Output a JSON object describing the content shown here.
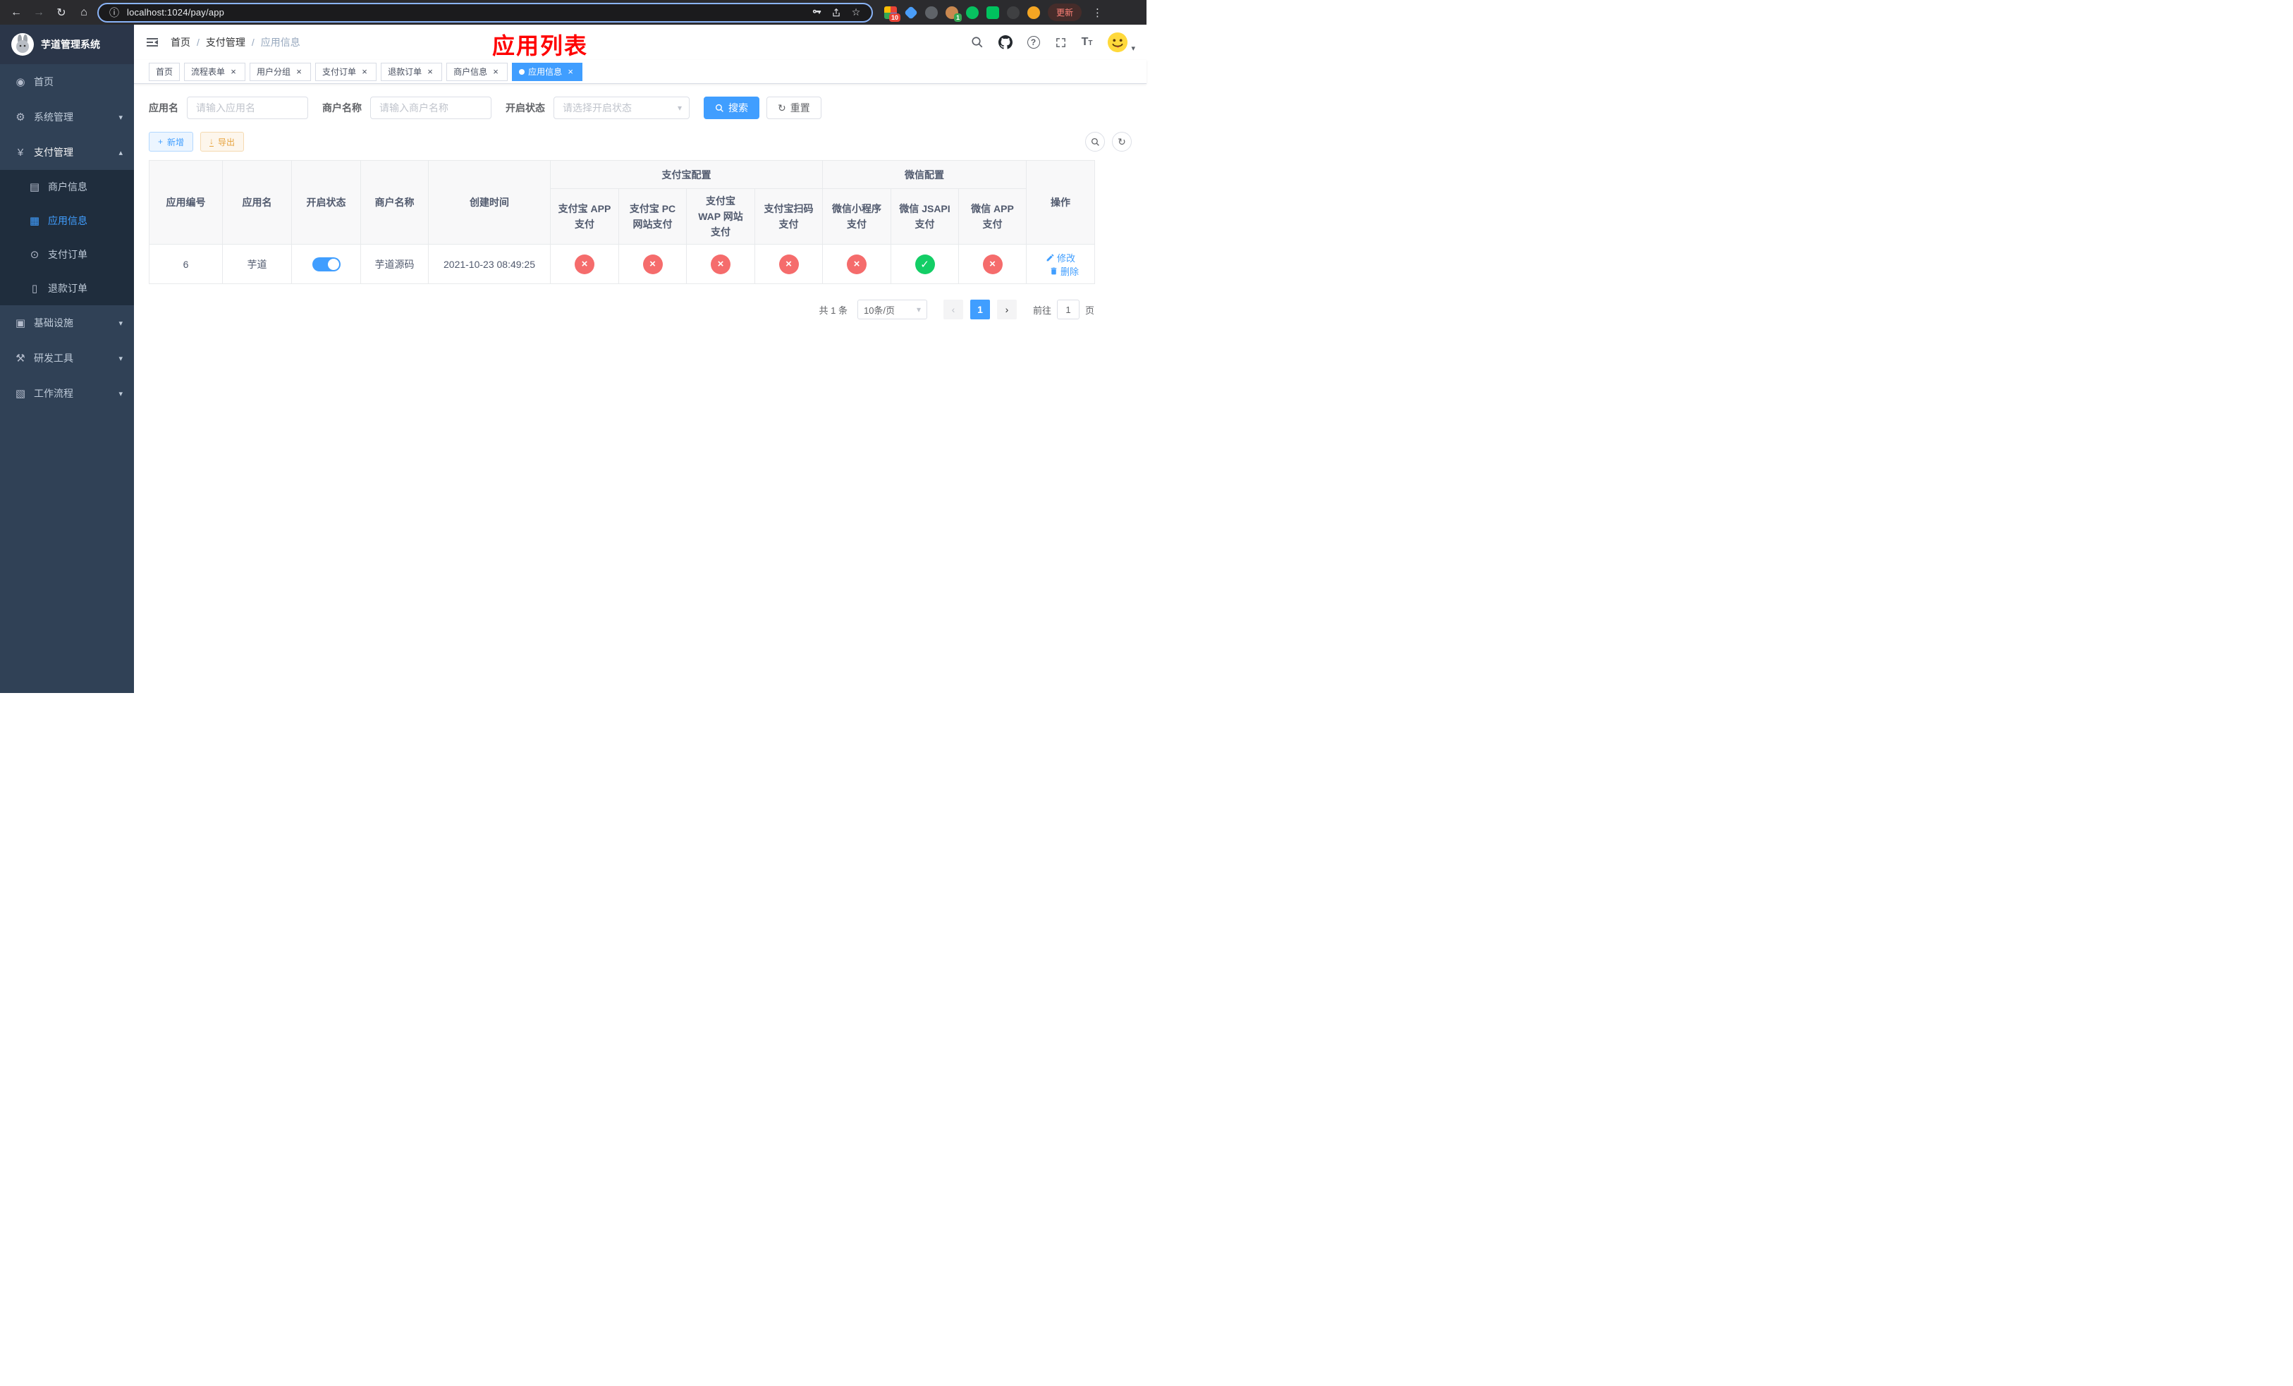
{
  "browser": {
    "url": "localhost:1024/pay/app",
    "update_label": "更新",
    "ext_badge_count": "10",
    "ext_badge_one": "1"
  },
  "sidebar": {
    "title": "芋道管理系统",
    "menu": [
      {
        "label": "首页"
      },
      {
        "label": "系统管理"
      },
      {
        "label": "支付管理"
      },
      {
        "label": "商户信息"
      },
      {
        "label": "应用信息"
      },
      {
        "label": "支付订单"
      },
      {
        "label": "退款订单"
      },
      {
        "label": "基础设施"
      },
      {
        "label": "研发工具"
      },
      {
        "label": "工作流程"
      }
    ]
  },
  "navbar": {
    "breadcrumb": {
      "home": "首页",
      "section": "支付管理",
      "current": "应用信息"
    },
    "annotation": "应用列表"
  },
  "tabs": [
    {
      "label": "首页"
    },
    {
      "label": "流程表单"
    },
    {
      "label": "用户分组"
    },
    {
      "label": "支付订单"
    },
    {
      "label": "退款订单"
    },
    {
      "label": "商户信息"
    },
    {
      "label": "应用信息"
    }
  ],
  "filters": {
    "app_name_label": "应用名",
    "app_name_placeholder": "请输入应用名",
    "merchant_label": "商户名称",
    "merchant_placeholder": "请输入商户名称",
    "status_label": "开启状态",
    "status_placeholder": "请选择开启状态",
    "search_label": "搜索",
    "reset_label": "重置"
  },
  "toolbar": {
    "add_label": "新增",
    "export_label": "导出"
  },
  "table": {
    "columns": {
      "id": "应用编号",
      "name": "应用名",
      "status": "开启状态",
      "merchant": "商户名称",
      "created": "创建时间",
      "group_alipay": "支付宝配置",
      "group_wechat": "微信配置",
      "alipay_app": "支付宝 APP 支付",
      "alipay_pc": "支付宝 PC 网站支付",
      "alipay_wap": "支付宝 WAP 网站支付",
      "alipay_qr": "支付宝扫码支付",
      "wx_mini": "微信小程序支付",
      "wx_jsapi": "微信 JSAPI 支付",
      "wx_app": "微信 APP 支付",
      "op": "操作"
    },
    "rows": [
      {
        "id": "6",
        "name": "芋道",
        "enabled": true,
        "merchant": "芋道源码",
        "created": "2021-10-23 08:49:25",
        "alipay_app": false,
        "alipay_pc": false,
        "alipay_wap": false,
        "alipay_qr": false,
        "wx_mini": false,
        "wx_jsapi": true,
        "wx_app": false,
        "edit_label": "修改",
        "delete_label": "删除"
      }
    ]
  },
  "pagination": {
    "total": "共 1 条",
    "page_size": "10条/页",
    "page": "1",
    "goto_label": "前往",
    "goto_value": "1",
    "page_unit": "页"
  },
  "icons": {
    "check": "✓",
    "cross": "×",
    "back": "←",
    "forward": "→",
    "reload": "↻",
    "home": "⌂",
    "info": "ⓘ",
    "star": "☆",
    "dots": "⋮",
    "dashboard": "◉",
    "gear": "⚙",
    "yen": "¥",
    "merchant": "▤",
    "app": "▦",
    "order": "⊙",
    "refund": "▯",
    "infra": "▣",
    "tools": "⚒",
    "workflow": "▧",
    "caret_down": "▾",
    "caret_up": "▴",
    "chevron_left": "‹",
    "chevron_right": "›",
    "plus": "+",
    "download": "↓",
    "question": "?",
    "font_size_big": "T",
    "font_size_small": "T"
  },
  "colors": {
    "primary": "#409eff",
    "success": "#13ce66",
    "danger": "#f56c6c",
    "warning": "#e6a23c",
    "annotation_red": "#ff0000",
    "sidebar_bg": "#304156",
    "submenu_bg": "#1f2d3d",
    "active_tab_bg": "#409eff"
  }
}
